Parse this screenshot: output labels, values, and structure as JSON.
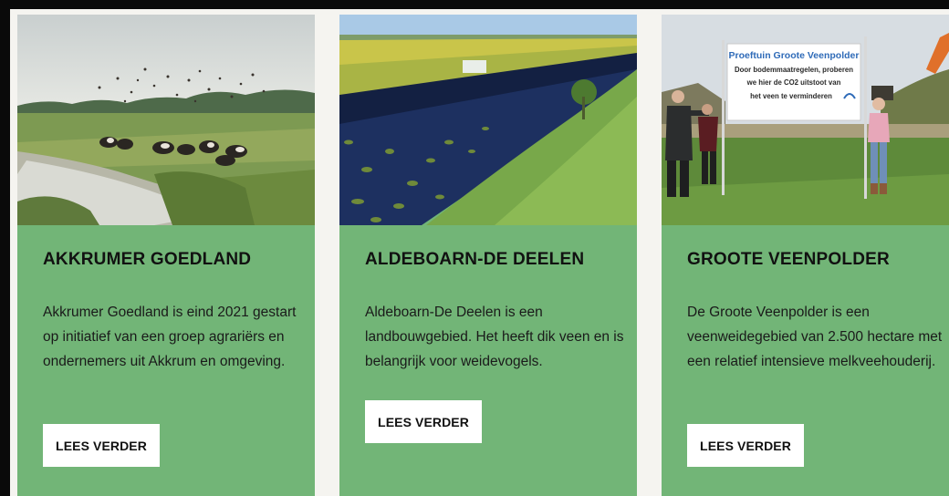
{
  "cards": [
    {
      "title": "AKKRUMER GOEDLAND",
      "description": "Akkrumer Goedland is eind 2021 gestart op initiatief van een groep agrariërs en ondernemers uit Akkrum en omgeving.",
      "button_label": "LEES VERDER",
      "image": "landscape with cows, birds and a ditch"
    },
    {
      "title": "ALDEBOARN-DE DEELEN",
      "description": "Aldeboarn-De Deelen is een landbouwgebied. Het heeft dik veen en is belangrijk voor weidevogels.",
      "button_label": "LEES VERDER",
      "image": "ditch with water lilies beside meadow"
    },
    {
      "title": "GROOTE VEENPOLDER",
      "description": "De Groote Veenpolder is een veenweidegebied van 2.500 hectare met een relatief intensieve melkveehouderij.",
      "button_label": "LEES VERDER",
      "image": "people beside a sign in a field",
      "sign": {
        "title": "Proeftuin Groote Veenpolder",
        "lines": [
          "Door bodemmaatregelen, proberen",
          "we hier de CO2 uitstoot van",
          "het veen te verminderen"
        ]
      }
    }
  ],
  "colors": {
    "card": "#72b577",
    "page": "#f5f4f0",
    "frame": "#0a0a0a"
  }
}
